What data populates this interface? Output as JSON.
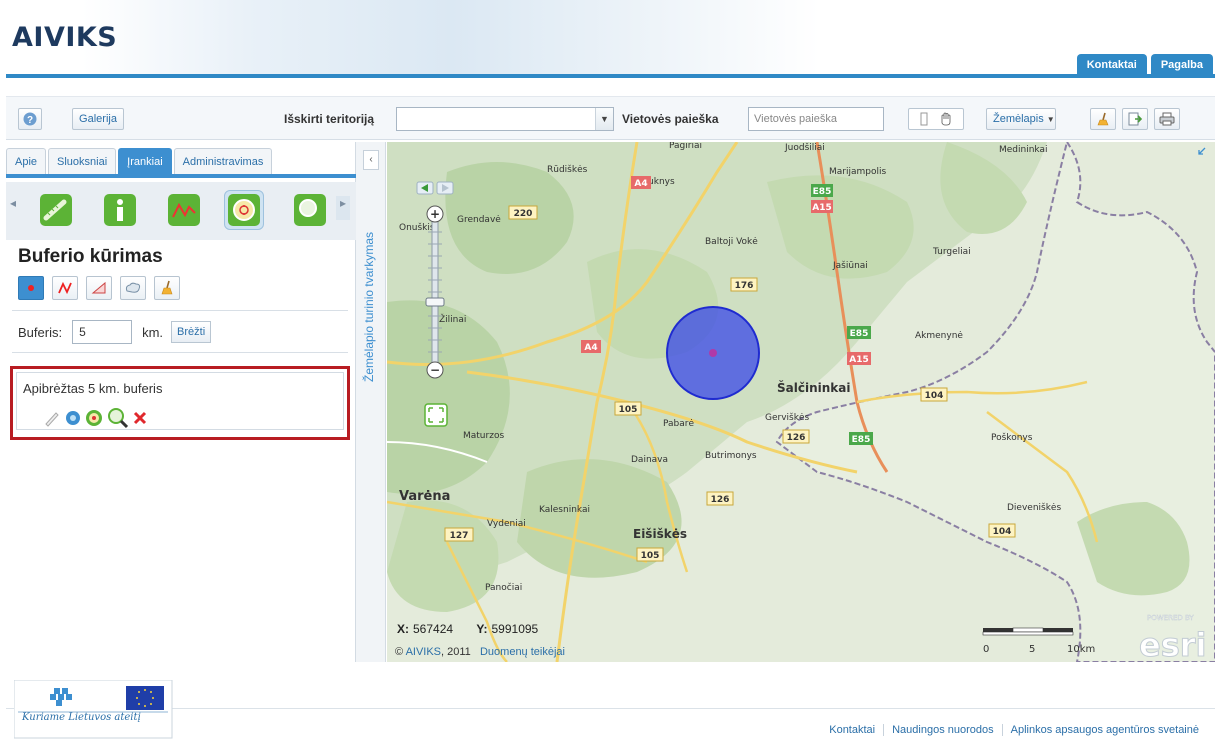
{
  "header": {
    "logo": "AIVIKS",
    "links": [
      "Kontaktai",
      "Pagalba"
    ]
  },
  "toolbar": {
    "help_icon": "question-icon",
    "gallery_label": "Galerija",
    "territory_label": "Išskirti teritoriją",
    "territory_value": "",
    "search_label": "Vietovės paieška",
    "search_placeholder": "Vietovės paieška",
    "basemap_label": "Žemėlapis",
    "colors": {
      "accent": "#2f89c6"
    }
  },
  "leftpanel": {
    "tabs": [
      "Apie",
      "Sluoksniai",
      "Įrankiai",
      "Administravimas"
    ],
    "active_tab": "Įrankiai",
    "tools": [
      "measure-icon",
      "info-icon",
      "profile-icon",
      "buffer-icon",
      "search-tool-icon"
    ],
    "section_title": "Buferio kūrimas",
    "draw_buttons": [
      "point-icon",
      "line-icon",
      "polygon-icon",
      "freehand-icon",
      "eraser-icon"
    ],
    "buffer_label": "Buferis:",
    "buffer_value": "5",
    "buffer_unit": "km.",
    "draw_button": "Brėžti",
    "result_text": "Apibrėžtas 5 km. buferis",
    "result_icons": [
      "edit-icon",
      "zoom-to-icon",
      "buffer-icon",
      "search-icon",
      "delete-icon"
    ]
  },
  "toc": {
    "label": "Žemėlapio turinio tvarkymas"
  },
  "map": {
    "places": [
      "Pagiriai",
      "Juodšiliai",
      "Medininkai",
      "Marijampolis",
      "Rūdiškės",
      "Paluknys",
      "Grendavė",
      "Onuškis",
      "Baltoji Vokė",
      "Turgeliai",
      "Jašiūnai",
      "Žilinai",
      "Akmenynė",
      "Šalčininkai",
      "Pabarė",
      "Gerviškės",
      "Maturzos",
      "Poškonys",
      "Dainava",
      "Butrimonys",
      "Varėna",
      "Kalesninkai",
      "Vydeniai",
      "Eišiškės",
      "Dieveniškės",
      "Panočiai"
    ],
    "road_labels": [
      "220",
      "A4",
      "E85",
      "A15",
      "176",
      "E85",
      "A15",
      "A4",
      "105",
      "104",
      "126",
      "E85",
      "126",
      "127",
      "105",
      "104"
    ],
    "coord_x_label": "X:",
    "coord_x": "567424",
    "coord_y_label": "Y:",
    "coord_y": "5991095",
    "copyright_prefix": "©",
    "copyright_link": "AIVIKS",
    "copyright_year": ", 2011",
    "data_providers": "Duomenų teikėjai",
    "scale_labels": [
      "0",
      "5",
      "10km"
    ],
    "powered_by": "POWERED BY",
    "esri": "esri",
    "buffer_color": "#3a48e8"
  },
  "footer": {
    "tagline": "Kuriame Lietuvos ateitį",
    "links": [
      "Kontaktai",
      "Naudingos nuorodos",
      "Aplinkos apsaugos agentūros svetainė"
    ]
  }
}
